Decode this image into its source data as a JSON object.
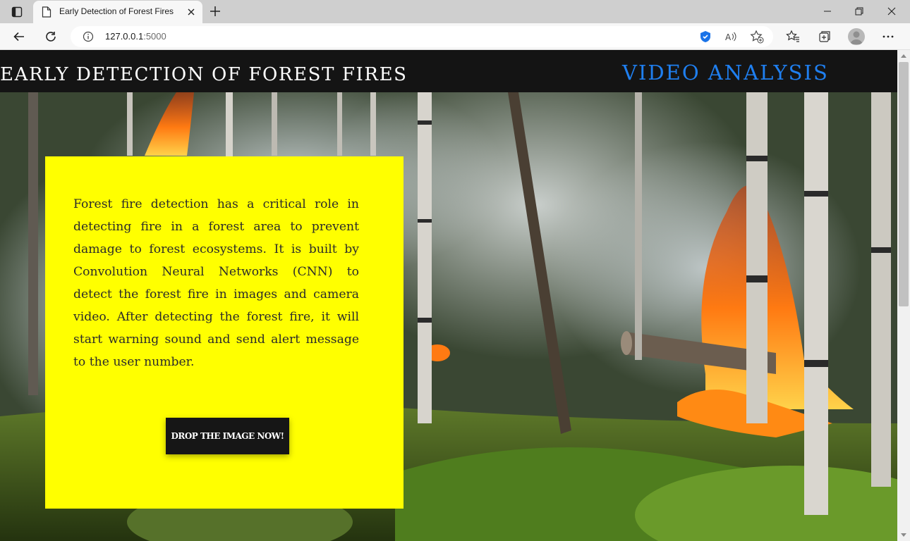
{
  "browser": {
    "tab_title": "Early Detection of Forest Fires",
    "url_host": "127.0.0.1",
    "url_port": ":5000"
  },
  "page": {
    "site_title": "EARLY DETECTION OF FOREST FIRES",
    "nav_link": "VIDEO ANALYSIS",
    "description": "Forest fire detection has a critical role in detecting fire in a forest area to prevent damage to forest ecosystems. It is built by Convolution Neural Networks (CNN) to detect the forest fire in images and camera video. After detecting the forest fire, it will start warning sound and send alert message to the user number.",
    "cta_label": "DROP THE IMAGE NOW!"
  },
  "colors": {
    "header_bg": "#141414",
    "nav_link": "#1f7ff0",
    "card_bg": "#ffff00",
    "button_bg": "#161616"
  },
  "icons": {
    "tab_actions": "tab-actions-icon",
    "favicon": "page-icon",
    "close": "close-icon",
    "new_tab": "plus-icon",
    "back": "back-arrow-icon",
    "refresh": "refresh-icon",
    "info": "info-icon",
    "shield": "tracking-prevention-icon",
    "read_aloud": "read-aloud-icon",
    "favorite_add": "star-plus-icon",
    "favorites": "favorites-icon",
    "collections": "collections-icon",
    "profile": "profile-avatar-icon",
    "more": "more-icon"
  }
}
